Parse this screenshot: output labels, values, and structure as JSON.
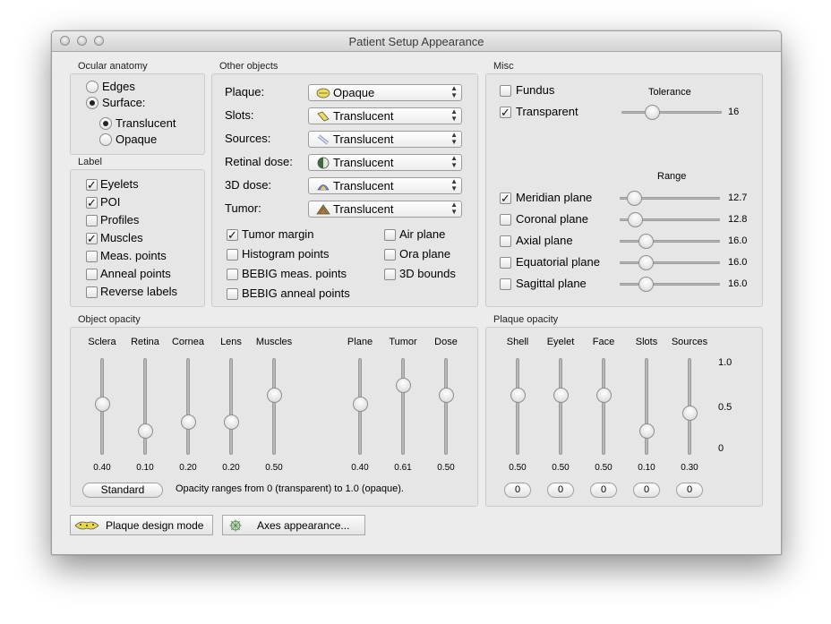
{
  "window": {
    "title": "Patient Setup Appearance"
  },
  "ocular": {
    "title": "Ocular anatomy",
    "edges": "Edges",
    "surface": "Surface:",
    "translucent": "Translucent",
    "opaque": "Opaque",
    "selected_mode": "Surface:",
    "selected_surface": "Translucent"
  },
  "label": {
    "title": "Label",
    "items": [
      {
        "label": "Eyelets",
        "checked": true
      },
      {
        "label": "POI",
        "checked": true
      },
      {
        "label": "Profiles",
        "checked": false
      },
      {
        "label": "Muscles",
        "checked": true
      },
      {
        "label": "Meas. points",
        "checked": false
      },
      {
        "label": "Anneal points",
        "checked": false
      },
      {
        "label": "Reverse labels",
        "checked": false
      }
    ]
  },
  "other": {
    "title": "Other objects",
    "rows": [
      {
        "label": "Plaque:",
        "value": "Opaque",
        "icon": "plaque-icon"
      },
      {
        "label": "Slots:",
        "value": "Translucent",
        "icon": "slots-icon"
      },
      {
        "label": "Sources:",
        "value": "Translucent",
        "icon": "sources-icon"
      },
      {
        "label": "Retinal dose:",
        "value": "Translucent",
        "icon": "retinal-dose-icon"
      },
      {
        "label": "3D dose:",
        "value": "Translucent",
        "icon": "3d-dose-icon"
      },
      {
        "label": "Tumor:",
        "value": "Translucent",
        "icon": "tumor-icon"
      }
    ],
    "checks_left": [
      {
        "label": "Tumor margin",
        "checked": true
      },
      {
        "label": "Histogram points",
        "checked": false
      },
      {
        "label": "BEBIG meas. points",
        "checked": false
      },
      {
        "label": "BEBIG anneal points",
        "checked": false
      }
    ],
    "checks_right": [
      {
        "label": "Air plane",
        "checked": false
      },
      {
        "label": "Ora plane",
        "checked": false
      },
      {
        "label": "3D bounds",
        "checked": false
      }
    ]
  },
  "misc": {
    "title": "Misc",
    "fundus": {
      "label": "Fundus",
      "checked": false
    },
    "transparent": {
      "label": "Transparent",
      "checked": true
    },
    "tolerance_label": "Tolerance",
    "tolerance": {
      "value": "16",
      "fraction": 0.3
    },
    "range_label": "Range",
    "planes": [
      {
        "label": "Meridian plane",
        "checked": true,
        "value": "12.7",
        "fraction": 0.14
      },
      {
        "label": "Coronal plane",
        "checked": false,
        "value": "12.8",
        "fraction": 0.15
      },
      {
        "label": "Axial plane",
        "checked": false,
        "value": "16.0",
        "fraction": 0.26
      },
      {
        "label": "Equatorial plane",
        "checked": false,
        "value": "16.0",
        "fraction": 0.26
      },
      {
        "label": "Sagittal plane",
        "checked": false,
        "value": "16.0",
        "fraction": 0.26
      }
    ]
  },
  "object_opacity": {
    "title": "Object opacity",
    "sliders": [
      {
        "label": "Sclera",
        "value": "0.40",
        "fraction": 0.4
      },
      {
        "label": "Retina",
        "value": "0.10",
        "fraction": 0.1
      },
      {
        "label": "Cornea",
        "value": "0.20",
        "fraction": 0.2
      },
      {
        "label": "Lens",
        "value": "0.20",
        "fraction": 0.2
      },
      {
        "label": "Muscles",
        "value": "0.50",
        "fraction": 0.5
      },
      {
        "label": "Plane",
        "value": "0.40",
        "fraction": 0.4
      },
      {
        "label": "Tumor",
        "value": "0.61",
        "fraction": 0.61
      },
      {
        "label": "Dose",
        "value": "0.50",
        "fraction": 0.5
      }
    ],
    "standard_button": "Standard",
    "note": "Opacity ranges from 0 (transparent) to 1.0 (opaque)."
  },
  "plaque_opacity": {
    "title": "Plaque opacity",
    "sliders": [
      {
        "label": "Shell",
        "value": "0.50",
        "fraction": 0.5,
        "field": "0"
      },
      {
        "label": "Eyelet",
        "value": "0.50",
        "fraction": 0.5,
        "field": "0"
      },
      {
        "label": "Face",
        "value": "0.50",
        "fraction": 0.5,
        "field": "0"
      },
      {
        "label": "Slots",
        "value": "0.10",
        "fraction": 0.1,
        "field": "0"
      },
      {
        "label": "Sources",
        "value": "0.30",
        "fraction": 0.3,
        "field": "0"
      }
    ],
    "scale": [
      "1.0",
      "0.5",
      "0"
    ]
  },
  "bottom": {
    "plaque_design": "Plaque design mode",
    "axes": "Axes appearance..."
  }
}
